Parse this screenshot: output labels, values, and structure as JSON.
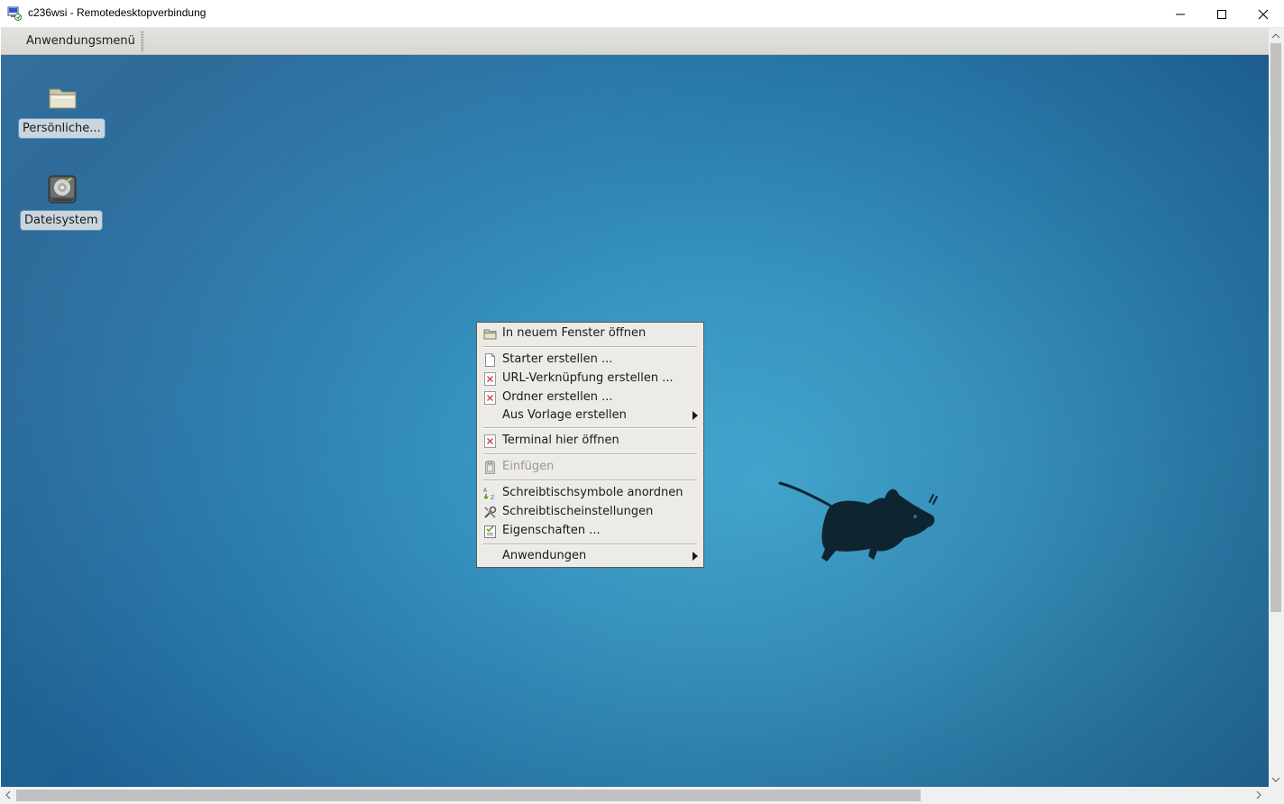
{
  "window": {
    "title": "c236wsi - Remotedesktopverbindung",
    "icon": "remote-desktop-icon",
    "controls": [
      "minimize-icon",
      "maximize-icon",
      "close-icon"
    ]
  },
  "panel": {
    "app_menu_label": "Anwendungsmenü"
  },
  "desktop": {
    "icons": [
      {
        "label": "Persönliche...",
        "icon": "home-folder-icon"
      },
      {
        "label": "Dateisystem",
        "icon": "filesystem-drive-icon"
      }
    ],
    "wallpaper": "xfce-mouse-logo",
    "colors": {
      "wallpaper_center": "#45acd6",
      "wallpaper_edge": "#1d5f92",
      "label_bg": "#c9d6e0"
    }
  },
  "context_menu": {
    "items": [
      {
        "label": "In neuem Fenster öffnen",
        "icon": "folder-open-icon",
        "enabled": true,
        "submenu": false
      },
      {
        "label": "Starter erstellen ...",
        "icon": "document-icon",
        "enabled": true,
        "submenu": false
      },
      {
        "label": "URL-Verknüpfung erstellen ...",
        "icon": "missing-image-icon",
        "enabled": true,
        "submenu": false
      },
      {
        "label": "Ordner erstellen ...",
        "icon": "missing-image-icon",
        "enabled": true,
        "submenu": false
      },
      {
        "label": "Aus Vorlage erstellen",
        "icon": "",
        "enabled": true,
        "submenu": true
      },
      {
        "label": "Terminal hier öffnen",
        "icon": "missing-image-icon",
        "enabled": true,
        "submenu": false
      },
      {
        "label": "Einfügen",
        "icon": "paste-icon",
        "enabled": false,
        "submenu": false
      },
      {
        "label": "Schreibtischsymbole anordnen",
        "icon": "sort-az-icon",
        "enabled": true,
        "submenu": false
      },
      {
        "label": "Schreibtischeinstellungen",
        "icon": "preferences-tools-icon",
        "enabled": true,
        "submenu": false
      },
      {
        "label": "Eigenschaften ...",
        "icon": "properties-icon",
        "enabled": true,
        "submenu": false
      },
      {
        "label": "Anwendungen",
        "icon": "",
        "enabled": true,
        "submenu": true
      }
    ]
  }
}
